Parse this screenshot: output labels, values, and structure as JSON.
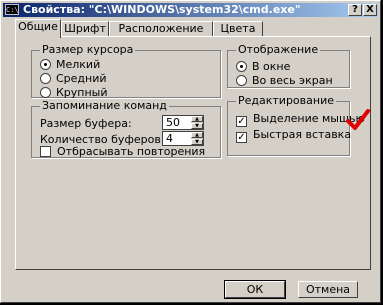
{
  "title": "Свойства: \"C:\\WINDOWS\\system32\\cmd.exe\"",
  "title_icon": "C:\\",
  "title_buttons": {
    "help": "?",
    "close": "X"
  },
  "tabs": [
    {
      "label": "Общие",
      "active": true
    },
    {
      "label": "Шрифт",
      "active": false
    },
    {
      "label": "Расположение",
      "active": false
    },
    {
      "label": "Цвета",
      "active": false
    }
  ],
  "cursor_size": {
    "legend": "Размер курсора",
    "options": [
      {
        "label": "Мелкий",
        "selected": true
      },
      {
        "label": "Средний",
        "selected": false
      },
      {
        "label": "Крупный",
        "selected": false
      }
    ]
  },
  "display": {
    "legend": "Отображение",
    "options": [
      {
        "label": "В окне",
        "selected": true
      },
      {
        "label": "Во весь экран",
        "selected": false
      }
    ]
  },
  "history": {
    "legend": "Запоминание команд",
    "buffer_size_label": "Размер буфера:",
    "buffer_size_value": "50",
    "buffer_count_label": "Количество буферов:",
    "buffer_count_value": "4",
    "discard_duplicates_label": "Отбрасывать повторения",
    "discard_duplicates_checked": false
  },
  "editing": {
    "legend": "Редактирование",
    "quick_edit_label": "Выделение мышью",
    "quick_edit_checked": true,
    "insert_mode_label": "Быстрая вставка",
    "insert_mode_checked": true
  },
  "buttons": {
    "ok": "ОК",
    "cancel": "Отмена"
  },
  "colors": {
    "annotation_check": "#e00000"
  }
}
